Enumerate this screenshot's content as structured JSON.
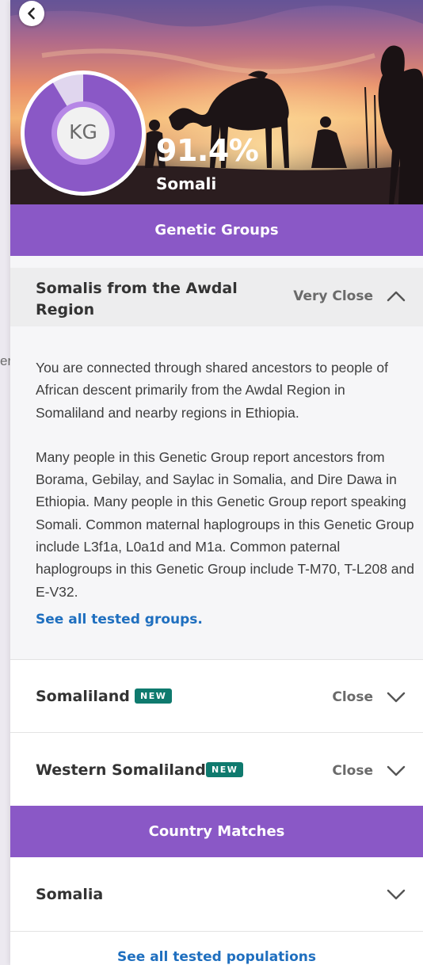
{
  "side_peek_text": "er",
  "hero": {
    "back_icon": "chevron-left-icon",
    "avatar_initials": "KG",
    "percentage": "91.4%",
    "percentage_value": 91.4,
    "population": "Somali",
    "colors": {
      "donut_fill": "#8a58c6",
      "donut_rest": "#e0d6ee",
      "ring": "#b687e6"
    }
  },
  "genetic_groups": {
    "title": "Genetic Groups",
    "expanded": {
      "title": "Somalis from the Awdal Region",
      "closeness": "Very Close",
      "paragraphs": [
        "You are connected through shared ancestors to people of African descent primarily from the Awdal Region in Somaliland and nearby regions in Ethiopia.",
        "Many people in this Genetic Group report ancestors from Borama, Gebilay, and Saylac in Somalia, and Dire Dawa in Ethiopia. Many people in this Genetic Group report speaking Somali. Common maternal haplogroups in this Genetic Group include L3f1a, L0a1d and M1a. Common paternal haplogroups in this Genetic Group include T-M70, T-L208 and E-V32."
      ],
      "link": "See all tested groups."
    },
    "items": [
      {
        "title": "Somaliland",
        "badge": "NEW",
        "closeness": "Close"
      },
      {
        "title": "Western Somaliland",
        "badge": "NEW",
        "closeness": "Close"
      }
    ]
  },
  "country_matches": {
    "title": "Country Matches",
    "items": [
      {
        "title": "Somalia"
      }
    ],
    "link": "See all tested populations"
  },
  "colors": {
    "accent_purple": "#8a58c6",
    "badge_teal": "#0f7a6e",
    "link_blue": "#1f6fbf"
  }
}
